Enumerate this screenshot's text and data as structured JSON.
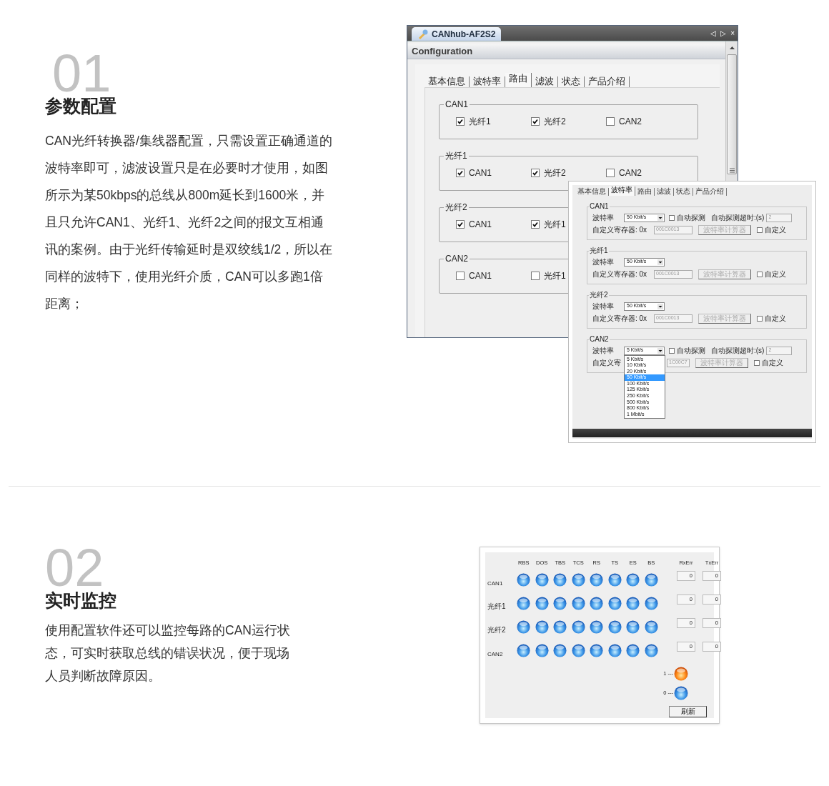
{
  "section1": {
    "number": "01",
    "heading": "参数配置",
    "body": "CAN光纤转换器/集线器配置，只需设置正确通道的波特率即可，滤波设置只是在必要时才使用，如图所示为某50kbps的总线从800m延长到1600米，并且只允许CAN1、光纤1、光纤2之间的报文互相通讯的案例。由于光纤传输延时是双绞线1/2，所以在同样的波特下，使用光纤介质，CAN可以多跑1倍距离；"
  },
  "routing_window": {
    "tab_title": "CANhub-AF2S2",
    "nav_glyphs": [
      "◁",
      "▷",
      "×"
    ],
    "panel_title": "Configuration",
    "tabs": [
      {
        "label": "基本信息",
        "selected": false
      },
      {
        "label": "波特率",
        "selected": false
      },
      {
        "label": "路由",
        "selected": true
      },
      {
        "label": "滤波",
        "selected": false
      },
      {
        "label": "状态",
        "selected": false
      },
      {
        "label": "产品介绍",
        "selected": false
      }
    ],
    "groups": [
      {
        "title": "CAN1",
        "options": [
          {
            "label": "光纤1",
            "checked": true
          },
          {
            "label": "光纤2",
            "checked": true
          },
          {
            "label": "CAN2",
            "checked": false
          }
        ]
      },
      {
        "title": "光纤1",
        "options": [
          {
            "label": "CAN1",
            "checked": true
          },
          {
            "label": "光纤2",
            "checked": true
          },
          {
            "label": "CAN2",
            "checked": false
          }
        ]
      },
      {
        "title": "光纤2",
        "options": [
          {
            "label": "CAN1",
            "checked": true
          },
          {
            "label": "光纤1",
            "checked": true
          }
        ]
      },
      {
        "title": "CAN2",
        "options": [
          {
            "label": "CAN1",
            "checked": false
          },
          {
            "label": "光纤1",
            "checked": false
          }
        ]
      }
    ]
  },
  "baudrate_window": {
    "tabs": [
      {
        "label": "基本信息",
        "selected": false
      },
      {
        "label": "波特率",
        "selected": true
      },
      {
        "label": "路由",
        "selected": false
      },
      {
        "label": "滤波",
        "selected": false
      },
      {
        "label": "状态",
        "selected": false
      },
      {
        "label": "产品介绍",
        "selected": false
      }
    ],
    "groups": [
      {
        "title": "CAN1",
        "rate_label": "波特率",
        "rate": "50 Kbit/s",
        "auto_detect": {
          "label": "自动探测",
          "checked": false
        },
        "timeout_label": "自动探测超时:(s)",
        "timeout_value": "2",
        "register_label": "自定义寄存器: 0x",
        "register_value": "001C0013",
        "calc_button": "波特率计算器",
        "custom": {
          "label": "自定义",
          "checked": false
        }
      },
      {
        "title": "光纤1",
        "rate_label": "波特率",
        "rate": "50 Kbit/s",
        "register_label": "自定义寄存器: 0x",
        "register_value": "001C0013",
        "calc_button": "波特率计算器",
        "custom": {
          "label": "自定义",
          "checked": false
        }
      },
      {
        "title": "光纤2",
        "rate_label": "波特率",
        "rate": "50 Kbit/s",
        "register_label": "自定义寄存器: 0x",
        "register_value": "001C0013",
        "calc_button": "波特率计算器",
        "custom": {
          "label": "自定义",
          "checked": false
        }
      },
      {
        "title": "CAN2",
        "rate_label": "波特率",
        "rate": "5 Kbit/s",
        "auto_detect": {
          "label": "自动探测",
          "checked": false
        },
        "timeout_label": "自动探测超时:(s)",
        "timeout_value": "2",
        "register_label": "自定义寄",
        "register_value": "1C00C7",
        "calc_button": "波特率计算器",
        "custom": {
          "label": "自定义",
          "checked": false
        },
        "open_list": [
          {
            "label": "5 Kbit/s",
            "selected": false
          },
          {
            "label": "10 Kbit/s",
            "selected": false
          },
          {
            "label": "20 Kbit/s",
            "selected": false
          },
          {
            "label": "50 Kbit/s",
            "selected": true
          },
          {
            "label": "100 Kbit/s",
            "selected": false
          },
          {
            "label": "125 Kbit/s",
            "selected": false
          },
          {
            "label": "250 Kbit/s",
            "selected": false
          },
          {
            "label": "500 Kbit/s",
            "selected": false
          },
          {
            "label": "800 Kbit/s",
            "selected": false
          },
          {
            "label": "1 Mbit/s",
            "selected": false
          }
        ]
      }
    ]
  },
  "section2": {
    "number": "02",
    "heading": "实时监控",
    "body": "使用配置软件还可以监控每路的CAN运行状态，可实时获取总线的错误状况，便于现场人员判断故障原因。"
  },
  "monitor": {
    "columns": [
      "RBS",
      "DOS",
      "TBS",
      "TCS",
      "RS",
      "TS",
      "ES",
      "BS"
    ],
    "err_columns": [
      "RxErr",
      "TxErr"
    ],
    "rows": [
      {
        "label": "CAN1",
        "leds": [
          {
            "on": false
          },
          {
            "on": false
          },
          {
            "on": false
          },
          {
            "on": false
          },
          {
            "on": false
          },
          {
            "on": false
          },
          {
            "on": false
          },
          {
            "on": false
          }
        ],
        "rx": "0",
        "tx": "0"
      },
      {
        "label": "光纤1",
        "leds": [
          {
            "on": false
          },
          {
            "on": false
          },
          {
            "on": false
          },
          {
            "on": false
          },
          {
            "on": false
          },
          {
            "on": false
          },
          {
            "on": false
          },
          {
            "on": false
          }
        ],
        "rx": "0",
        "tx": "0"
      },
      {
        "label": "光纤2",
        "leds": [
          {
            "on": false
          },
          {
            "on": false
          },
          {
            "on": false
          },
          {
            "on": false
          },
          {
            "on": false
          },
          {
            "on": false
          },
          {
            "on": false
          },
          {
            "on": false
          }
        ],
        "rx": "0",
        "tx": "0"
      },
      {
        "label": "CAN2",
        "leds": [
          {
            "on": false
          },
          {
            "on": false
          },
          {
            "on": false
          },
          {
            "on": false
          },
          {
            "on": false
          },
          {
            "on": false
          },
          {
            "on": false
          },
          {
            "on": false
          }
        ],
        "rx": "0",
        "tx": "0"
      }
    ],
    "legend": [
      {
        "label": "1 ---",
        "on": true
      },
      {
        "label": "0 ---",
        "on": false
      }
    ],
    "refresh_button": "刷新"
  }
}
